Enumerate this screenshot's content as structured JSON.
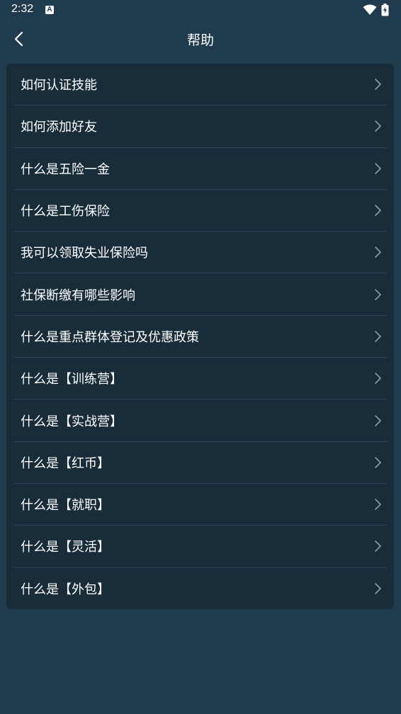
{
  "status_bar": {
    "time": "2:32",
    "a_badge": "A"
  },
  "header": {
    "title": "帮助"
  },
  "help_items": [
    "如何认证技能",
    "如何添加好友",
    "什么是五险一金",
    "什么是工伤保险",
    "我可以领取失业保险吗",
    "社保断缴有哪些影响",
    "什么是重点群体登记及优惠政策",
    "什么是【训练营】",
    "什么是【实战营】",
    "什么是【红币】",
    "什么是【就职】",
    "什么是【灵活】",
    "什么是【外包】"
  ],
  "colors": {
    "background": "#1f3b4d",
    "card": "#192c39",
    "divider": "#2d4453",
    "chevron": "#8d9ba4"
  },
  "icons": {
    "back": "chevron-left-icon",
    "item_arrow": "chevron-right-icon",
    "wifi": "wifi-icon",
    "battery": "battery-charging-icon"
  }
}
